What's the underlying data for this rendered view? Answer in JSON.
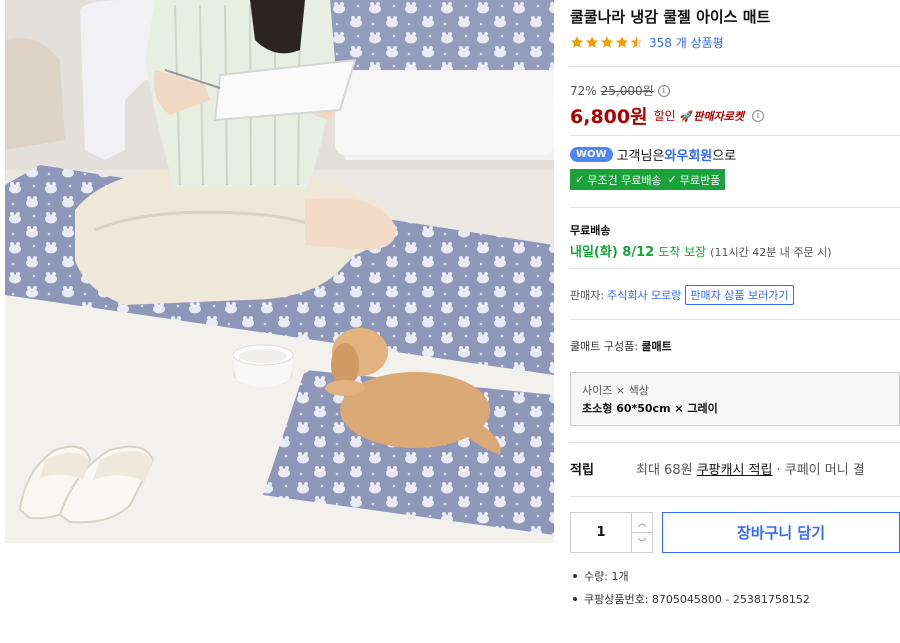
{
  "product": {
    "title": "쿨쿨나라 냉감 쿨젤 아이스 매트",
    "rating_stars": 4.5,
    "review_count": "358 개 상품평"
  },
  "price": {
    "discount_rate": "72%",
    "original_price": "25,000원",
    "sale_price": "6,800원",
    "sale_label": "할인",
    "rocket_badge": "판매자로켓"
  },
  "wow": {
    "badge": "WOW",
    "text_before": "고객님은 ",
    "member": "와우회원",
    "text_after": "으로"
  },
  "benefits": [
    "무조건 무료배송",
    "무료반품"
  ],
  "shipping": {
    "label": "무료배송",
    "date": "내일(화) 8/12",
    "guarantee": "도착 보장",
    "deadline": "(11시간 42분 내 주문 시)"
  },
  "seller": {
    "label": "판매자:",
    "name": "주식회사 모로랑",
    "button": "판매자 상품 보러가기"
  },
  "option": {
    "title_prefix": "쿨매트 구성품: ",
    "title_value": "쿨매트",
    "label": "사이즈 × 색상",
    "value": "초소형 60*50cm × 그레이"
  },
  "reward": {
    "label": "적립",
    "text": "최대 68원",
    "link": "쿠팡캐시 적립",
    "text2": "· 쿠페이 머니 결"
  },
  "cart": {
    "quantity": "1",
    "button": "장바구니 담기"
  },
  "details": [
    "수량: 1개",
    "쿠팡상품번호: 8705045800 - 25381758152"
  ],
  "colors": {
    "price_red": "#ae0000",
    "link_blue": "#346aff",
    "badge_green": "#1aa33b",
    "star_orange": "#f0a000"
  },
  "icons": [
    "star-icon",
    "info-icon",
    "rocket-icon",
    "check-icon",
    "chevron-up-icon",
    "chevron-down-icon"
  ]
}
